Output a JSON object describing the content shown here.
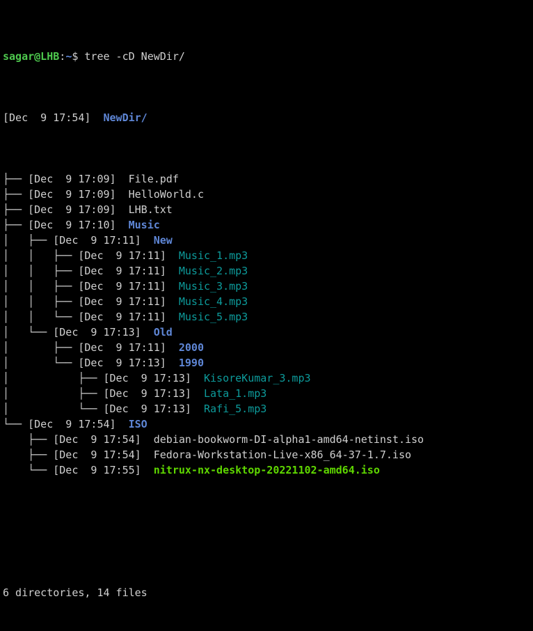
{
  "terminal": {
    "background": "#000000",
    "foreground": "#d0d0d0",
    "colors": {
      "prompt_user_host": "#4ec94e",
      "prompt_path": "#5f87d7",
      "directory": "#5f87d7",
      "regular_file": "#d0d0d0",
      "audio_file": "#0d9b9b",
      "executable_file": "#5fd700",
      "tree_lines": "#c8c8c8"
    }
  },
  "prompt": {
    "user_host": "sagar@LHB",
    "colon": ":",
    "path": "~",
    "symbol": "$",
    "command": "tree -cD NewDir/"
  },
  "tree": {
    "root": {
      "prefix": "",
      "date": "[Dec  9 17:54]",
      "gap": "  ",
      "name": "NewDir/",
      "type": "directory"
    },
    "entries": [
      {
        "prefix": "├── ",
        "date": "[Dec  9 17:09]",
        "gap": "  ",
        "name": "File.pdf",
        "type": "file"
      },
      {
        "prefix": "├── ",
        "date": "[Dec  9 17:09]",
        "gap": "  ",
        "name": "HelloWorld.c",
        "type": "file"
      },
      {
        "prefix": "├── ",
        "date": "[Dec  9 17:09]",
        "gap": "  ",
        "name": "LHB.txt",
        "type": "file"
      },
      {
        "prefix": "├── ",
        "date": "[Dec  9 17:10]",
        "gap": "  ",
        "name": "Music",
        "type": "directory"
      },
      {
        "prefix": "│   ├── ",
        "date": "[Dec  9 17:11]",
        "gap": "  ",
        "name": "New",
        "type": "directory"
      },
      {
        "prefix": "│   │   ├── ",
        "date": "[Dec  9 17:11]",
        "gap": "  ",
        "name": "Music_1.mp3",
        "type": "audio"
      },
      {
        "prefix": "│   │   ├── ",
        "date": "[Dec  9 17:11]",
        "gap": "  ",
        "name": "Music_2.mp3",
        "type": "audio"
      },
      {
        "prefix": "│   │   ├── ",
        "date": "[Dec  9 17:11]",
        "gap": "  ",
        "name": "Music_3.mp3",
        "type": "audio"
      },
      {
        "prefix": "│   │   ├── ",
        "date": "[Dec  9 17:11]",
        "gap": "  ",
        "name": "Music_4.mp3",
        "type": "audio"
      },
      {
        "prefix": "│   │   └── ",
        "date": "[Dec  9 17:11]",
        "gap": "  ",
        "name": "Music_5.mp3",
        "type": "audio"
      },
      {
        "prefix": "│   └── ",
        "date": "[Dec  9 17:13]",
        "gap": "  ",
        "name": "Old",
        "type": "directory"
      },
      {
        "prefix": "│       ├── ",
        "date": "[Dec  9 17:11]",
        "gap": "  ",
        "name": "2000",
        "type": "directory"
      },
      {
        "prefix": "│       └── ",
        "date": "[Dec  9 17:13]",
        "gap": "  ",
        "name": "1990",
        "type": "directory"
      },
      {
        "prefix": "│           ├── ",
        "date": "[Dec  9 17:13]",
        "gap": "  ",
        "name": "KisoreKumar_3.mp3",
        "type": "audio"
      },
      {
        "prefix": "│           ├── ",
        "date": "[Dec  9 17:13]",
        "gap": "  ",
        "name": "Lata_1.mp3",
        "type": "audio"
      },
      {
        "prefix": "│           └── ",
        "date": "[Dec  9 17:13]",
        "gap": "  ",
        "name": "Rafi_5.mp3",
        "type": "audio"
      },
      {
        "prefix": "└── ",
        "date": "[Dec  9 17:54]",
        "gap": "  ",
        "name": "ISO",
        "type": "directory"
      },
      {
        "prefix": "    ├── ",
        "date": "[Dec  9 17:54]",
        "gap": "  ",
        "name": "debian-bookworm-DI-alpha1-amd64-netinst.iso",
        "type": "file"
      },
      {
        "prefix": "    ├── ",
        "date": "[Dec  9 17:54]",
        "gap": "  ",
        "name": "Fedora-Workstation-Live-x86_64-37-1.7.iso",
        "type": "file"
      },
      {
        "prefix": "    └── ",
        "date": "[Dec  9 17:55]",
        "gap": "  ",
        "name": "nitrux-nx-desktop-20221102-amd64.iso",
        "type": "executable"
      }
    ]
  },
  "summary": {
    "text": "6 directories, 14 files",
    "directories": 6,
    "files": 14
  }
}
